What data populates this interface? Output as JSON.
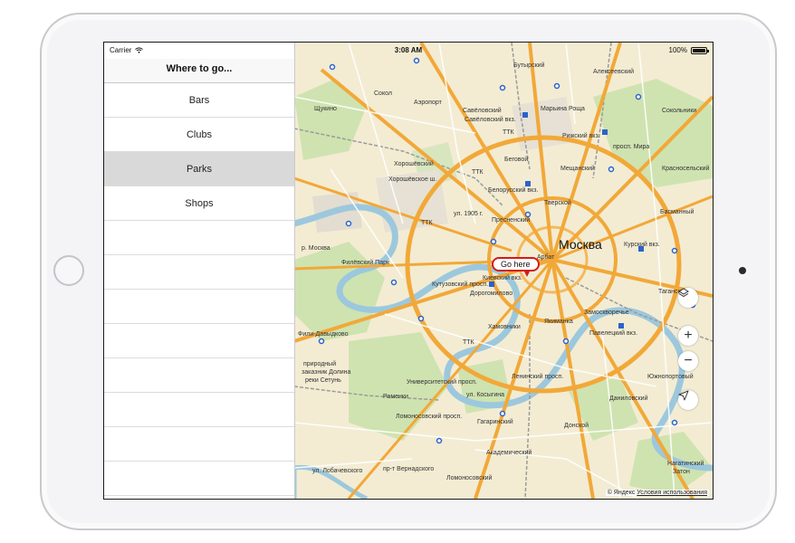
{
  "status": {
    "carrier": "Carrier",
    "time": "3:08 AM",
    "battery": "100%",
    "battery_level": 1.0
  },
  "sidebar": {
    "title": "Where to go...",
    "items": [
      {
        "label": "Bars",
        "selected": false
      },
      {
        "label": "Clubs",
        "selected": false
      },
      {
        "label": "Parks",
        "selected": true
      },
      {
        "label": "Shops",
        "selected": false
      },
      {
        "label": ""
      },
      {
        "label": ""
      },
      {
        "label": ""
      },
      {
        "label": ""
      },
      {
        "label": ""
      },
      {
        "label": ""
      },
      {
        "label": ""
      },
      {
        "label": ""
      }
    ]
  },
  "map": {
    "city": "Москва",
    "pin_label": "Go here",
    "labels": {
      "butyrsky": "Бутырский",
      "alekseevsky": "Алексеевский",
      "sokol": "Сокол",
      "aeroport": "Аэропорт",
      "savelovsky": "Савёловский",
      "savelovsky_vkz": "Савёловский вкз.",
      "marina_roshcha": "Марьина Роща",
      "shchukino": "Щукино",
      "sokolniki": "Сокольники",
      "rizhsky_vkz": "Рижский вкз.",
      "ttk1": "ТТК",
      "ttk2": "ТТК",
      "ttk3": "ТТК",
      "ttk4": "ТТК",
      "khoroshevsky": "Хорошёвский",
      "khoroshevskoe_sh": "Хорошёвское ш.",
      "begovoy": "Беговой",
      "meshchansky": "Мещанский",
      "krasnoselsky": "Красносельский",
      "belorussky_vkz": "Белорусский вкз.",
      "tverskoy": "Тверской",
      "basmanny": "Басманный",
      "prospekt_mira": "просп. Мира",
      "presnensky": "Пресненский",
      "ul_1905": "ул. 1905 г.",
      "kursky_vkz": "Курский вкз.",
      "r_moskva": "р. Москва",
      "filevsky_park": "Филёвский Парк",
      "kutuzovsky_prosp": "Кутузовский просп.",
      "dorogomilovo": "Дорогомилово",
      "kievsky_vkz": "Киевский вкз.",
      "arbat": "Арбат",
      "tagansky": "Таганский",
      "zamoskvorechye": "Замоскворечье",
      "yakimanka": "Якиманка",
      "khamovniki": "Хамовники",
      "fili_davydkovo": "Фили-Давыдково",
      "paveletsky_vkz": "Павелецкий вкз.",
      "prirodny": "природный",
      "zakaznik": "заказник Долина",
      "reki_setun": "реки Сетунь",
      "universitetsky": "Университетский просп.",
      "ul_kosygina": "ул. Косыгина",
      "leninsky_prosp": "Ленинский просп.",
      "ramenki": "Раменки",
      "danilovsky": "Даниловский",
      "yuzhnoportovy": "Южнопортовый",
      "lomonosovsky_prosp": "Ломоносовский просп.",
      "gagarinsky": "Гагаринский",
      "donskoy": "Донской",
      "akademichesky": "Академический",
      "ul_vernadskogo": "пр-т Вернадского",
      "ul_lobachevskogo": "ул. Лобачевского",
      "lomonosovsky": "Ломоносовский",
      "nagatinsky": "Нагатинский",
      "zaton": "Затон"
    },
    "attribution": {
      "brand": "© Яндекс",
      "terms": "Условия использования"
    },
    "controls": {
      "layers": "layers-icon",
      "zoom_in": "+",
      "zoom_out": "−",
      "locate": "location-arrow-icon"
    }
  }
}
